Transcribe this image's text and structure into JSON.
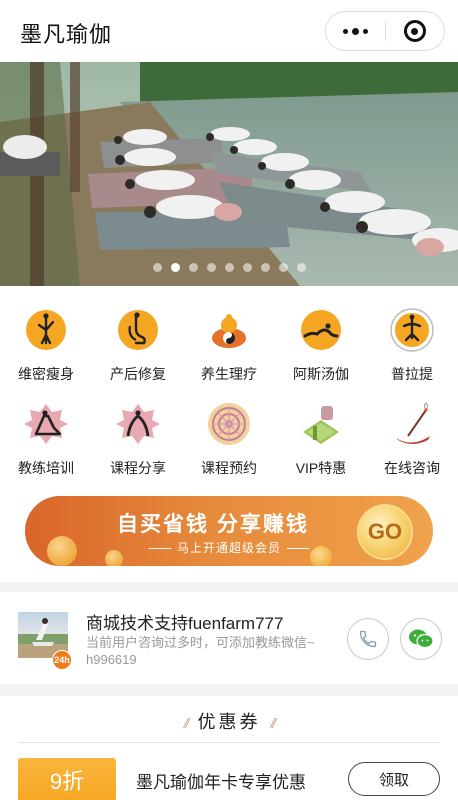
{
  "header": {
    "title": "墨凡瑜伽"
  },
  "banner": {
    "dot_count": 9,
    "active_index": 1
  },
  "grid": {
    "items": [
      {
        "label": "维密瘦身",
        "icon": "yoga-pose-icon"
      },
      {
        "label": "产后修复",
        "icon": "postnatal-yoga-icon"
      },
      {
        "label": "养生理疗",
        "icon": "meditation-yinyang-icon"
      },
      {
        "label": "阿斯汤伽",
        "icon": "ashtanga-pose-icon"
      },
      {
        "label": "普拉提",
        "icon": "pilates-mandala-icon"
      },
      {
        "label": "教练培训",
        "icon": "coach-training-lotus-icon"
      },
      {
        "label": "课程分享",
        "icon": "course-share-lotus-icon"
      },
      {
        "label": "课程预约",
        "icon": "course-booking-mandala-icon"
      },
      {
        "label": "VIP特惠",
        "icon": "vip-yoga-mat-icon"
      },
      {
        "label": "在线咨询",
        "icon": "incense-icon"
      }
    ]
  },
  "promo": {
    "headline": "自买省钱 分享赚钱",
    "subline": "马上开通超级会员",
    "go_label": "GO"
  },
  "support": {
    "name": "商城技术支持fuenfarm777",
    "desc": "当前用户咨询过多时，可添加教练微信~ h996619",
    "badge": "24h"
  },
  "coupon": {
    "section_title": "优惠券",
    "discount": "9折",
    "name": "墨凡瑜伽年卡专享优惠",
    "claim_label": "领取"
  },
  "colors": {
    "accent_orange": "#f5a623",
    "promo_orange": "#e0742f",
    "wechat_green": "#3dae3a"
  }
}
